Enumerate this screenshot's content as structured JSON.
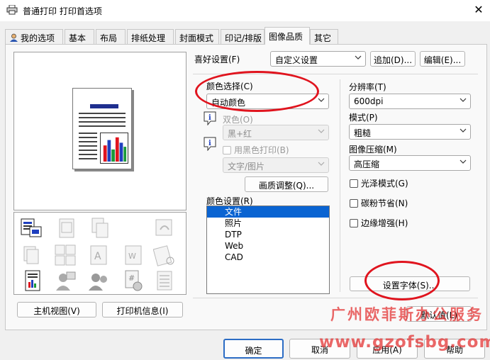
{
  "window": {
    "title": "普通打印 打印首选项",
    "close_glyph": "✕"
  },
  "tabs": [
    {
      "label": "我的选项",
      "active": false
    },
    {
      "label": "基本",
      "active": false
    },
    {
      "label": "布局",
      "active": false
    },
    {
      "label": "排纸处理",
      "active": false
    },
    {
      "label": "封面模式",
      "active": false
    },
    {
      "label": "印记/排版",
      "active": false
    },
    {
      "label": "图像品质",
      "active": true
    },
    {
      "label": "其它",
      "active": false
    }
  ],
  "left": {
    "host_view_button": "主机视图(V)",
    "printer_info_button": "打印机信息(I)"
  },
  "favorites": {
    "label": "喜好设置(F)",
    "value": "自定义设置",
    "add_button": "追加(D)...",
    "edit_button": "编辑(E)..."
  },
  "color": {
    "label": "颜色选择(C)",
    "value": "自动颜色",
    "two_color_label": "双色(O)",
    "two_color_value": "黑+红",
    "black_print_label": "用黑色打印(B)",
    "black_print_value": "文字/图片",
    "quality_adjust_button": "画质调整(Q)...",
    "settings_label": "颜色设置(R)",
    "settings_items": [
      {
        "label": "文件",
        "selected": true
      },
      {
        "label": "照片",
        "selected": false
      },
      {
        "label": "DTP",
        "selected": false
      },
      {
        "label": "Web",
        "selected": false
      },
      {
        "label": "CAD",
        "selected": false
      }
    ]
  },
  "right": {
    "resolution_label": "分辨率(T)",
    "resolution_value": "600dpi",
    "mode_label": "模式(P)",
    "mode_value": "粗糙",
    "compression_label": "图像压缩(M)",
    "compression_value": "高压缩",
    "gloss_label": "光泽模式(G)",
    "toner_save_label": "碳粉节省(N)",
    "edge_enhance_label": "边缘增强(H)",
    "font_settings_button": "设置字体(S)..."
  },
  "footer": {
    "default_button": "默认值(L)",
    "ok_button": "确定",
    "cancel_button": "取消",
    "apply_button": "应用(A)",
    "help_button": "帮助"
  },
  "watermark": {
    "line1": "广州欧菲斯办公服务",
    "line2": "www.gzofsbg.com"
  },
  "colors": {
    "annotation_red": "#e0141e",
    "selection_blue": "#0a64d2",
    "default_button_border": "#2b6cc4",
    "watermark_red": "#e22d2d"
  }
}
